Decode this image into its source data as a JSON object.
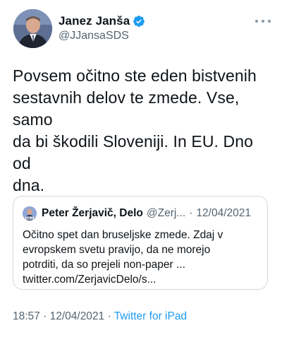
{
  "author": {
    "name": "Janez Janša",
    "handle": "@JJansaSDS",
    "verified": true
  },
  "tweet": {
    "text_lines": [
      "Povsem očitno ste eden bistvenih",
      "sestavnih delov te zmede. Vse, samo",
      "da bi škodili Sloveniji. In EU. Dno od",
      "dna."
    ]
  },
  "quoted": {
    "author_name": "Peter Žerjavič, Delo",
    "handle": "@Zerj...",
    "separator": "·",
    "date": "12/04/2021",
    "avatar_label": "DELO",
    "text_lines": [
      "Očitno spet dan bruseljske zmede. Zdaj v",
      "evropskem svetu pravijo, da ne morejo",
      "potrditi, da so prejeli non-paper ...",
      "twitter.com/ZerjavicDelo/s..."
    ]
  },
  "meta": {
    "time": "18:57",
    "separator": "·",
    "date": "12/04/2021",
    "source": "Twitter for iPad"
  },
  "colors": {
    "verified_blue": "#1d9bf0",
    "secondary_text": "#536471",
    "border": "#cfd9de"
  },
  "icons": {
    "verified": "verified-badge-icon",
    "more": "more-options-icon"
  }
}
